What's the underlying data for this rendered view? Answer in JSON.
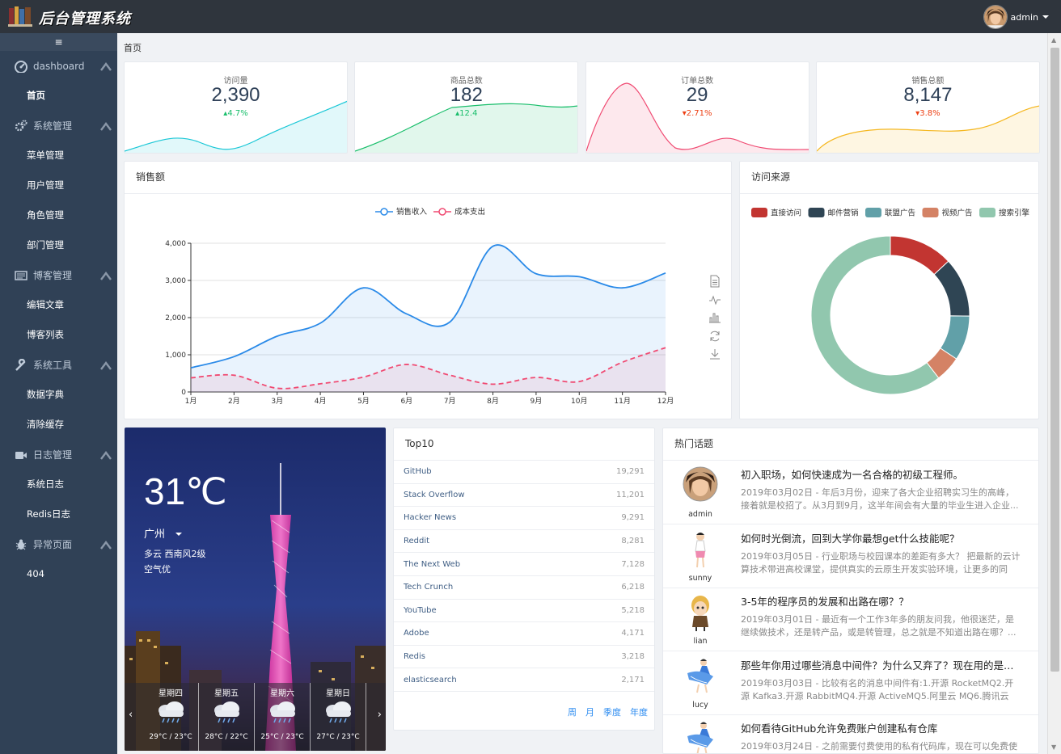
{
  "app": {
    "title": "后台管理系统",
    "user": "admin"
  },
  "sidebar": {
    "collapse_icon": "≡",
    "groups": [
      {
        "label": "dashboard",
        "icon": "dashboard-icon",
        "items": [
          "首页"
        ]
      },
      {
        "label": "系统管理",
        "icon": "gears-icon",
        "items": [
          "菜单管理",
          "用户管理",
          "角色管理",
          "部门管理"
        ]
      },
      {
        "label": "博客管理",
        "icon": "list-icon",
        "items": [
          "编辑文章",
          "博客列表"
        ]
      },
      {
        "label": "系统工具",
        "icon": "wrench-icon",
        "items": [
          "数据字典",
          "清除缓存"
        ]
      },
      {
        "label": "日志管理",
        "icon": "video-icon",
        "items": [
          "系统日志",
          "Redis日志"
        ]
      },
      {
        "label": "异常页面",
        "icon": "bug-icon",
        "items": [
          "404"
        ]
      }
    ]
  },
  "breadcrumb": "首页",
  "stats": [
    {
      "label": "访问量",
      "value": "2,390",
      "change": "4.7%",
      "dir": "up",
      "color": "#19c7d6"
    },
    {
      "label": "商品总数",
      "value": "182",
      "change": "12.4",
      "dir": "up",
      "color": "#19be6b"
    },
    {
      "label": "订单总数",
      "value": "29",
      "change": "2.71%",
      "dir": "down",
      "color": "#f04a72"
    },
    {
      "label": "销售总额",
      "value": "8,147",
      "change": "3.8%",
      "dir": "down",
      "color": "#f5b71f"
    }
  ],
  "sales": {
    "title": "销售额",
    "chart_data": {
      "type": "line",
      "categories": [
        "1月",
        "2月",
        "3月",
        "4月",
        "5月",
        "6月",
        "7月",
        "8月",
        "9月",
        "10月",
        "11月",
        "12月"
      ],
      "series": [
        {
          "name": "销售收入",
          "values": [
            650,
            950,
            1500,
            1850,
            2800,
            2100,
            1880,
            3920,
            3180,
            3100,
            2800,
            3200
          ],
          "color": "#2a8ae8",
          "style": "solid"
        },
        {
          "name": "成本支出",
          "values": [
            380,
            450,
            100,
            220,
            400,
            740,
            450,
            210,
            390,
            280,
            800,
            1190
          ],
          "color": "#f04a72",
          "style": "dashed"
        }
      ],
      "ylim": [
        0,
        4000
      ],
      "yticks": [
        "0",
        "1,000",
        "2,000",
        "3,000",
        "4,000"
      ],
      "grid": true,
      "legend": "top-center"
    },
    "toolbox": [
      "data-view-icon",
      "line-chart-icon",
      "bar-chart-icon",
      "restore-icon",
      "download-icon"
    ]
  },
  "source": {
    "title": "访问来源",
    "chart_data": {
      "type": "pie",
      "labels": [
        "直接访问",
        "邮件营销",
        "联盟广告",
        "视频广告",
        "搜索引擎"
      ],
      "values": [
        335,
        310,
        234,
        135,
        1548
      ],
      "colors": [
        "#c23531",
        "#2f4554",
        "#61a0a8",
        "#d48265",
        "#91c7ae"
      ],
      "legend": "top"
    }
  },
  "weather": {
    "temp": "31℃",
    "city": "广州",
    "desc": "多云  西南风2级",
    "air": "空气优",
    "forecast": [
      {
        "day": "星期四",
        "range": "29°C / 23°C"
      },
      {
        "day": "星期五",
        "range": "28°C / 22°C"
      },
      {
        "day": "星期六",
        "range": "25°C / 23°C"
      },
      {
        "day": "星期日",
        "range": "27°C / 23°C"
      }
    ]
  },
  "top10": {
    "title": "Top10",
    "rows": [
      {
        "name": "GitHub",
        "value": "19,291"
      },
      {
        "name": "Stack Overflow",
        "value": "11,201"
      },
      {
        "name": "Hacker News",
        "value": "9,291"
      },
      {
        "name": "Reddit",
        "value": "8,281"
      },
      {
        "name": "The Next Web",
        "value": "7,128"
      },
      {
        "name": "Tech Crunch",
        "value": "6,218"
      },
      {
        "name": "YouTube",
        "value": "5,218"
      },
      {
        "name": "Adobe",
        "value": "4,171"
      },
      {
        "name": "Redis",
        "value": "3,218"
      },
      {
        "name": "elasticsearch",
        "value": "2,171"
      }
    ],
    "periods": [
      "周",
      "月",
      "季度",
      "年度"
    ]
  },
  "topics": {
    "title": "热门话题",
    "items": [
      {
        "author": "admin",
        "title": "初入职场，如何快速成为一名合格的初级工程师。",
        "desc": "2019年03月02日 - 年后3月份，迎来了各大企业招聘实习生的高峰，接着就是校招了。从3月到9月，这半年间会有大量的毕业生进入企业..."
      },
      {
        "author": "sunny",
        "title": "如何时光倒流，回到大学你最想get什么技能呢？",
        "desc": "2019年03月05日 - 行业职场与校园课本的差距有多大？ 把最新的云计算技术带进高校课堂，提供真实的云原生开发实验环境，让更多的同学..."
      },
      {
        "author": "lian",
        "title": "3-5年的程序员的发展和出路在哪？？",
        "desc": "2019年03月01日 - 最近有一个工作3年多的朋友问我，他很迷茫，是继续做技术，还是转产品，或是转管理，总之就是不知道出路在哪？..."
      },
      {
        "author": "lucy",
        "title": "那些年你用过哪些消息中间件？为什么又弃了？现在用的是什么呢？",
        "desc": "2019年03月03日 - 比较有名的消息中间件有:1.开源 RocketMQ2.开源 Kafka3.开源 RabbitMQ4.开源 ActiveMQ5.阿里云 MQ6.腾讯云 CKafka..."
      },
      {
        "author": "lucy",
        "title": "如何看待GitHub允许免费账户创建私有仓库",
        "desc": "2019年03月24日 - 之前需要付费使用的私有代码库，现在可以免费使用了..."
      }
    ]
  }
}
